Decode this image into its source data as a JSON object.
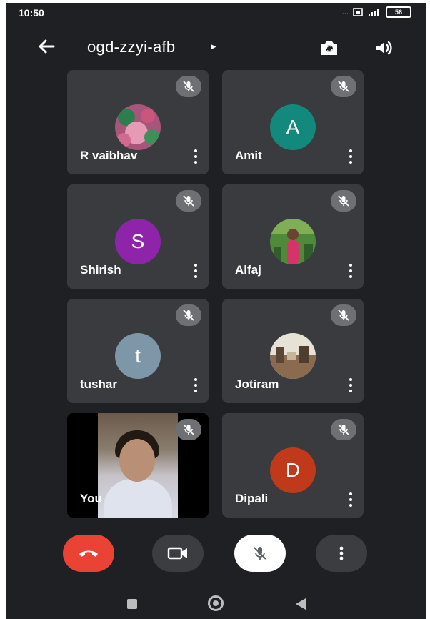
{
  "status_bar": {
    "time": "10:50",
    "icons": "... ",
    "battery": "56"
  },
  "header": {
    "meeting_code": "ogd-zzyi-afb",
    "caret": "▸"
  },
  "participants": [
    {
      "name": "R vaibhav",
      "avatar_type": "photo",
      "muted": true
    },
    {
      "name": "Amit",
      "initial": "A",
      "avatar_color": "#13897d",
      "muted": true
    },
    {
      "name": "Shirish",
      "initial": "S",
      "avatar_color": "#8e24aa",
      "muted": true
    },
    {
      "name": "Alfaj",
      "avatar_type": "photo",
      "muted": true
    },
    {
      "name": "tushar",
      "initial": "t",
      "avatar_color": "#7d97a8",
      "muted": true
    },
    {
      "name": "Jotiram",
      "avatar_type": "photo",
      "muted": true
    },
    {
      "name": "You",
      "avatar_type": "self-video",
      "muted": true
    },
    {
      "name": "Dipali",
      "initial": "D",
      "avatar_color": "#c0391b",
      "muted": true
    }
  ],
  "colors": {
    "background": "#1f2023",
    "tile": "#3a3b3f",
    "end_call": "#ea4335",
    "control": "#3c3d41",
    "mic_button": "#ffffff"
  },
  "icons": {
    "back": "arrow-left-icon",
    "switch_camera": "switch-camera-icon",
    "speaker": "speaker-icon",
    "muted": "mic-off-icon",
    "more": "more-vertical-icon",
    "end_call": "end-call-icon",
    "video": "video-camera-icon",
    "mic": "mic-off-icon"
  }
}
